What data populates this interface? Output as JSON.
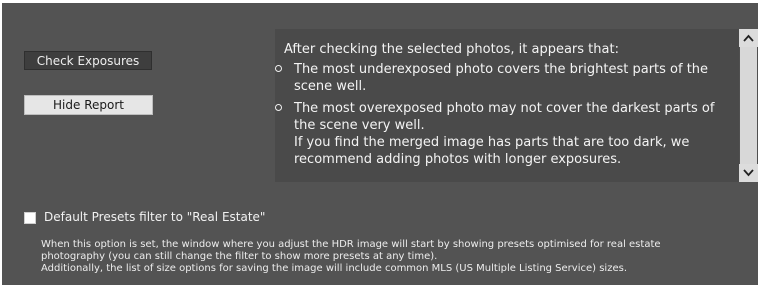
{
  "buttons": {
    "check_exposures": "Check Exposures",
    "hide_report": "Hide Report"
  },
  "report": {
    "intro": "After checking the selected photos, it appears that:",
    "items": [
      "The most underexposed photo covers the brightest parts of the scene well.",
      "The most overexposed photo may not cover the darkest parts of the scene very well.\nIf you find the merged image has parts that are too dark, we recommend adding photos with longer exposures."
    ]
  },
  "option": {
    "label": "Default Presets filter to \"Real Estate\"",
    "checked": false,
    "description_lines": [
      "When this option is set, the window where you adjust the HDR image will start by showing presets optimised for real estate",
      "photography (you can still change the filter to show more presets at any time).",
      "Additionally, the list of size options for saving the image will include common MLS (US Multiple Listing Service) sizes."
    ]
  },
  "icons": {
    "scroll_up": "chevron-up-icon",
    "scroll_down": "chevron-down-icon",
    "bullet": "hollow-circle-bullet"
  },
  "colors": {
    "panel_background": "#535353",
    "report_background": "#4a4a4a",
    "text": "#f2f2f2"
  }
}
